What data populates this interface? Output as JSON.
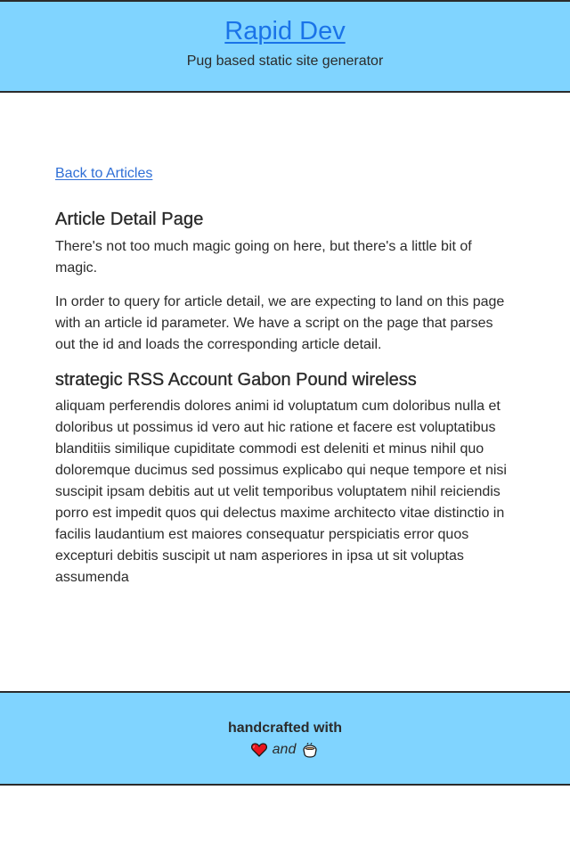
{
  "header": {
    "title": "Rapid Dev",
    "tagline": "Pug based static site generator"
  },
  "main": {
    "back_link": "Back to Articles",
    "page_heading": "Article Detail Page",
    "intro_paragraphs": [
      "There's not too much magic going on here, but there's a little bit of magic.",
      "In order to query for article detail, we are expecting to land on this page with an article id parameter. We have a script on the page that parses out the id and loads the corresponding article detail."
    ],
    "article": {
      "title": "strategic RSS Account Gabon Pound wireless",
      "body": "aliquam perferendis dolores animi id voluptatum cum doloribus nulla et doloribus ut possimus id vero aut hic ratione et facere est voluptatibus blanditiis similique cupiditate commodi est deleniti et minus nihil quo doloremque ducimus sed possimus explicabo qui neque tempore et nisi suscipit ipsam debitis aut ut velit temporibus voluptatem nihil reiciendis porro est impedit quos qui delectus maxime architecto vitae distinctio in facilis laudantium est maiores consequatur perspiciatis error quos excepturi debitis suscipit ut nam asperiores in ipsa ut sit voluptas assumenda"
    }
  },
  "footer": {
    "line1": "handcrafted with",
    "and_text": "and",
    "icons": [
      "heart-icon",
      "coffee-icon"
    ]
  },
  "colors": {
    "header_bg": "#80d4ff",
    "footer_bg": "#80d4ff",
    "link": "#2f6fd6",
    "title_link": "#1a73e8",
    "text": "#2b2b2b",
    "heart": "#e8141e"
  }
}
